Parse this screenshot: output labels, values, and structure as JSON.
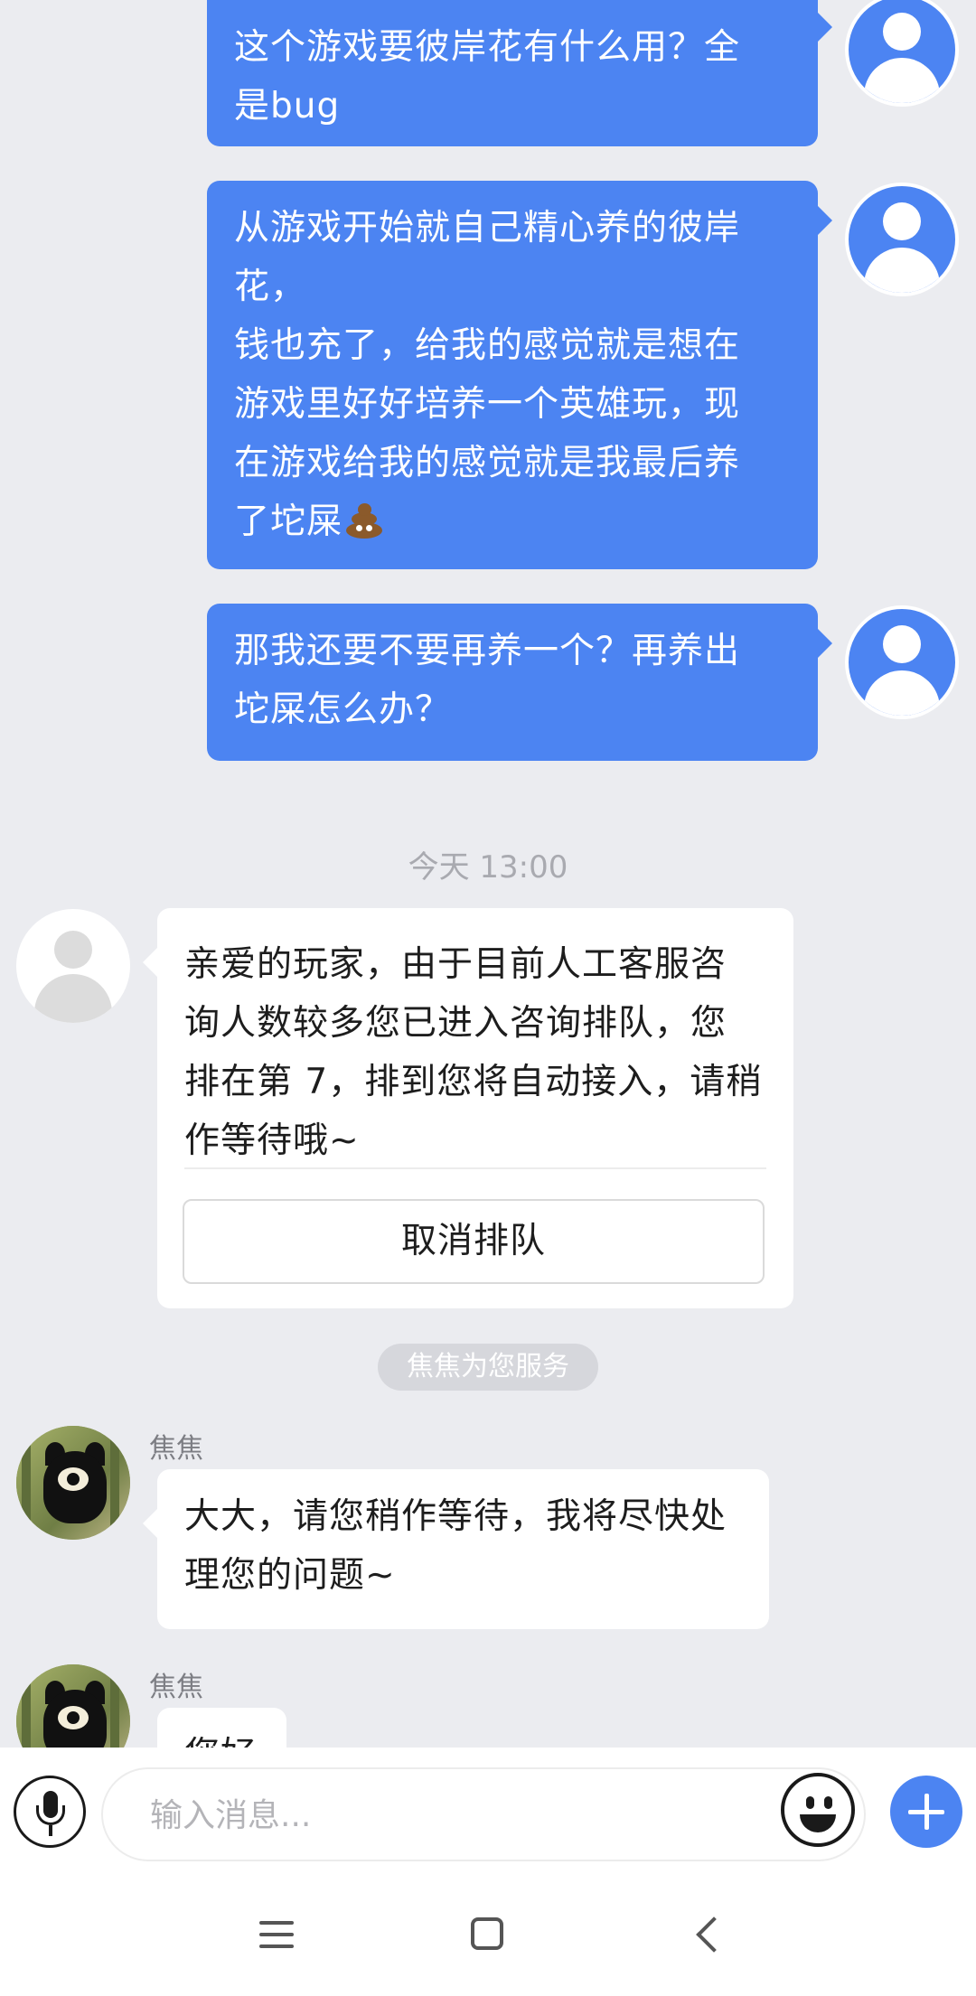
{
  "messages_out": [
    {
      "lines": [
        "这个游戏要彼岸花有什么用？全",
        "是bug"
      ]
    },
    {
      "lines": [
        "从游戏开始就自己精心养的彼岸",
        "花，",
        "钱也充了，给我的感觉就是想在",
        "游戏里好好培养一个英雄玩，现",
        "在游戏给我的感觉就是我最后养",
        "了坨屎"
      ],
      "trailing_emoji": "poop-emoji"
    },
    {
      "lines": [
        "那我还要不要再养一个？再养出",
        "坨屎怎么办？"
      ]
    }
  ],
  "timestamp": "今天 13:00",
  "system_message": {
    "lines": [
      "亲爱的玩家，由于目前人工客服咨",
      "询人数较多您已进入咨询排队，您",
      "排在第 7，排到您将自动接入，请稍",
      "作等待哦~"
    ],
    "cancel_button": "取消排队"
  },
  "service_pill": "焦焦为您服务",
  "agent": {
    "name": "焦焦",
    "messages": [
      {
        "lines": [
          "大大，请您稍作等待，我将尽快处",
          "理您的问题~"
        ]
      },
      {
        "lines": [
          "您好"
        ]
      }
    ]
  },
  "input": {
    "placeholder": "输入消息..."
  },
  "colors": {
    "accent": "#4c84f2",
    "background": "#ebecf0",
    "bubble_in": "#ffffff"
  },
  "icons": [
    "user-avatar-icon",
    "system-avatar-icon",
    "agent-avatar",
    "mic-icon",
    "emoji-icon",
    "plus-icon",
    "menu-icon",
    "home-icon",
    "back-icon"
  ]
}
